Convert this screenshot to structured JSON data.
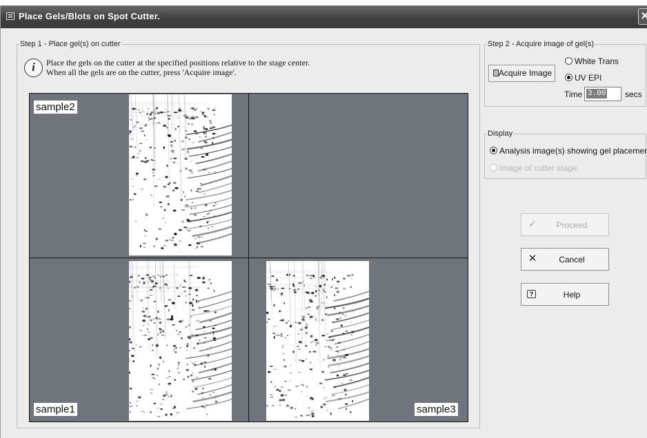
{
  "window": {
    "title": "Place Gels/Blots on Spot Cutter.",
    "close_glyph": "✕"
  },
  "step1": {
    "legend": "Step 1 - Place gel(s) on cutter",
    "info_line1": "Place the gels on the cutter at the specified positions relative to the stage center.",
    "info_line2": "When all the gels are on the cutter, press 'Acquire image'.",
    "info_glyph": "i",
    "samples": [
      "sample2",
      "sample1",
      "sample3"
    ]
  },
  "step2": {
    "legend": "Step 2 - Acquire image of gel(s)",
    "acquire_label": "Acquire Image",
    "radio_white": "White Trans",
    "radio_uv": "UV EPI",
    "selected": "UV EPI",
    "time_label": "Time",
    "time_value": "3.00",
    "time_unit": "secs"
  },
  "display": {
    "legend": "Display",
    "option1": "Analysis image(s) showing gel placement",
    "option2": "Image of cutter stage",
    "selected": "Analysis image(s) showing gel placement"
  },
  "buttons": {
    "proceed": "Proceed",
    "cancel": "Cancel",
    "help": "Help",
    "proceed_enabled": false
  },
  "colors": {
    "stage": "#6f757b",
    "titlebar": "#404040",
    "dialog_bg": "#ececec"
  },
  "icons": [
    "window-menu-icon",
    "close-icon",
    "info-icon",
    "camera-icon",
    "checkmark-icon",
    "cancel-x-icon",
    "help-icon"
  ]
}
